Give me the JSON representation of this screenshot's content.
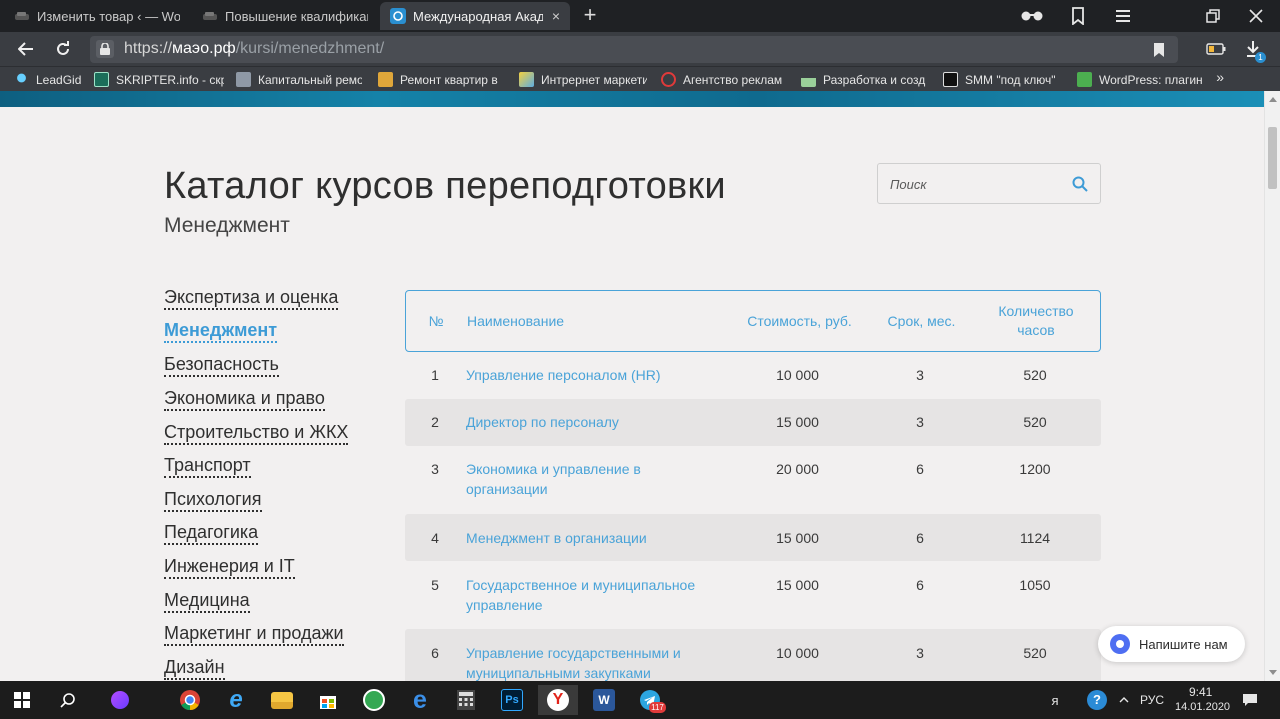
{
  "browser": {
    "tabs": [
      {
        "label": "Изменить товар ‹ — Word",
        "active": false
      },
      {
        "label": "Повышение квалификаци",
        "active": false
      },
      {
        "label": "Международная Академ",
        "active": true
      }
    ],
    "close_glyph": "×",
    "new_tab_glyph": "+",
    "url_scheme": "https://",
    "url_host": "маэо.рф",
    "url_path": "/kursi/menedzhment/",
    "bookmarks": [
      "LeadGid",
      "SKRIPTER.info - скр",
      "Капитальный ремо",
      "Ремонт квартир в",
      "Интрернет маркети",
      "Агентство реклам",
      "Разработка и созд",
      "SMM \"под ключ\"",
      "WordPress: плагин"
    ],
    "bookmarks_more": "»",
    "download_count": "1",
    "icons": [
      "glasses-icon",
      "collections-icon",
      "menu-icon",
      "restore-icon",
      "close-icon",
      "back-icon",
      "reload-icon",
      "lock-icon",
      "bookmark-icon",
      "battery-icon",
      "download-icon"
    ]
  },
  "page": {
    "title": "Каталог курсов переподготовки",
    "subtitle": "Менеджмент",
    "search": {
      "placeholder": "Поиск"
    },
    "sidebar": [
      {
        "label": "Экспертиза и оценка",
        "active": false
      },
      {
        "label": "Менеджмент",
        "active": true
      },
      {
        "label": "Безопасность",
        "active": false
      },
      {
        "label": "Экономика и право",
        "active": false
      },
      {
        "label": "Строительство и ЖКХ",
        "active": false
      },
      {
        "label": "Транспорт",
        "active": false
      },
      {
        "label": "Психология",
        "active": false
      },
      {
        "label": "Педагогика",
        "active": false
      },
      {
        "label": "Инженерия и IT",
        "active": false
      },
      {
        "label": "Медицина",
        "active": false
      },
      {
        "label": "Маркетинг и продажи",
        "active": false
      },
      {
        "label": "Дизайн",
        "active": false
      }
    ],
    "table": {
      "headers": {
        "num": "№",
        "name": "Наименование",
        "price": "Стоимость, руб.",
        "term": "Срок, мес.",
        "hours": "Количество часов"
      },
      "rows": [
        {
          "num": "1",
          "name": "Управление персоналом (HR)",
          "price": "10 000",
          "term": "3",
          "hours": "520"
        },
        {
          "num": "2",
          "name": "Директор по персоналу",
          "price": "15 000",
          "term": "3",
          "hours": "520"
        },
        {
          "num": "3",
          "name": "Экономика и управление в организации",
          "price": "20 000",
          "term": "6",
          "hours": "1200"
        },
        {
          "num": "4",
          "name": "Менеджмент в организации",
          "price": "15 000",
          "term": "6",
          "hours": "1124"
        },
        {
          "num": "5",
          "name": "Государственное и муниципальное управление",
          "price": "15 000",
          "term": "6",
          "hours": "1050"
        },
        {
          "num": "6",
          "name": "Управление государственными и муниципальными закупками",
          "price": "10 000",
          "term": "3",
          "hours": "520"
        }
      ]
    },
    "chat_label": "Напишите нам"
  },
  "taskbar": {
    "telegram_badge": "117",
    "lang": "РУС",
    "time": "9:41",
    "date": "14.01.2020"
  },
  "colors": {
    "accent": "#4aa3d8",
    "active_link": "#3d9bd6",
    "page_bg": "#f2f0f0",
    "row_alt": "#e6e4e4"
  }
}
